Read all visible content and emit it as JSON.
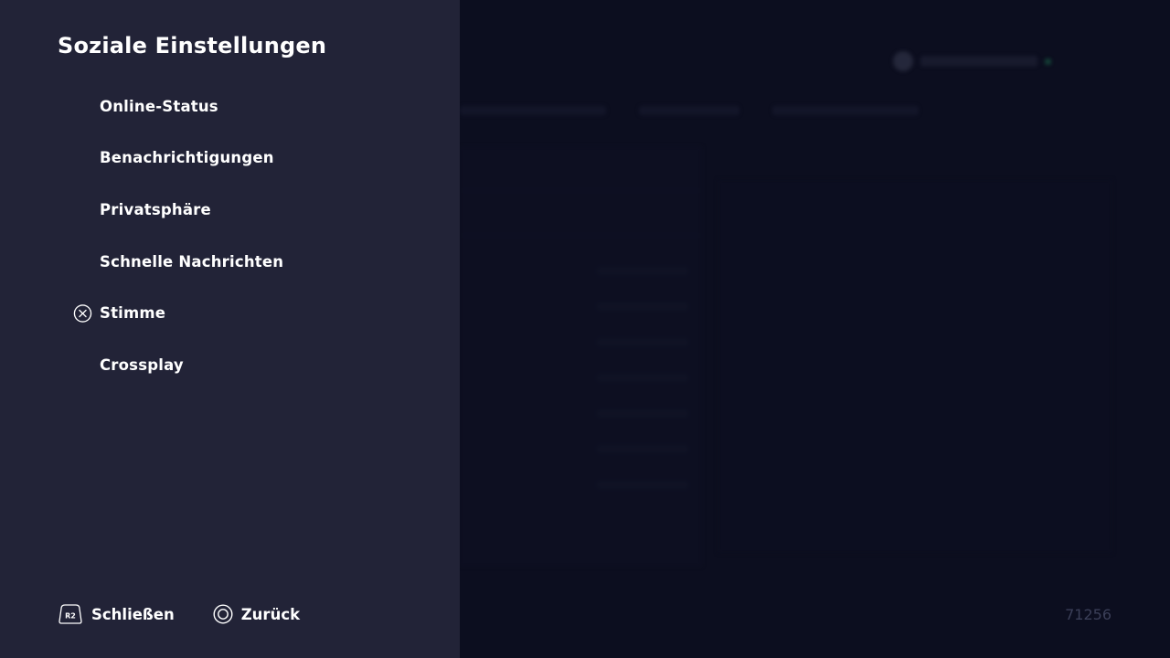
{
  "panel": {
    "title": "Soziale Einstellungen",
    "items": [
      {
        "label": "Online-Status"
      },
      {
        "label": "Benachrichtigungen"
      },
      {
        "label": "Privatsphäre"
      },
      {
        "label": "Schnelle Nachrichten"
      },
      {
        "label": "Stimme",
        "selected": true,
        "icon": "cross-button-icon"
      },
      {
        "label": "Crossplay"
      }
    ]
  },
  "footer": {
    "close": {
      "button": "R2",
      "icon": "r2-trigger-icon",
      "label": "Schließen"
    },
    "back": {
      "icon": "circle-button-icon",
      "label": "Zurück"
    }
  },
  "build_number": "71256",
  "colors": {
    "panel_background": "#222337",
    "dimmed_background": "#0c0e1f",
    "text": "#ffffff",
    "build_number_text": "#3b3f58"
  }
}
